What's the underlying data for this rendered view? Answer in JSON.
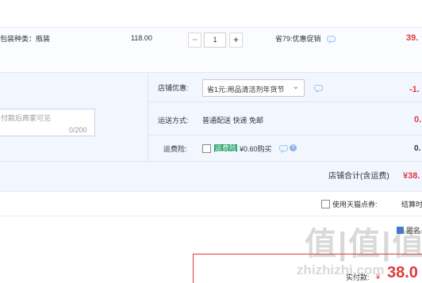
{
  "product": {
    "spec": "包装种类：瓶装",
    "price": "118.00",
    "qty_minus": "−",
    "quantity": "1",
    "qty_plus": "+",
    "promo": "省79:优惠促销",
    "subtotal": "39."
  },
  "shop": {
    "note_placeholder": "付款后商家可见",
    "note_counter": "0/200",
    "discount_label": "店铺优惠:",
    "discount_value": "省1元:用品清洁剂年货节",
    "discount_amount": "-1.",
    "shipping_label": "运送方式:",
    "shipping_value": "普通配送 快递 免邮",
    "shipping_amount": "0.",
    "insurance_label": "运费险:",
    "insurance_tag": "运费险",
    "insurance_value": "¥0.60购买",
    "insurance_amount": "0."
  },
  "shop_total": {
    "label": "店铺合计(含运费)",
    "amount": "¥38."
  },
  "coupon": {
    "label": "使用天猫点券:",
    "right_text": "结算时"
  },
  "anon": {
    "label": "匿名"
  },
  "payment": {
    "label": "实付款:",
    "currency": "¥",
    "amount": "38.0"
  },
  "watermark": {
    "logo_text": "值|值|值",
    "site": "zhizhizhi.com"
  },
  "colors": {
    "accent_red": "#e4393c",
    "section_bg": "#f2f7ff",
    "link_blue": "#3a7bd5"
  }
}
